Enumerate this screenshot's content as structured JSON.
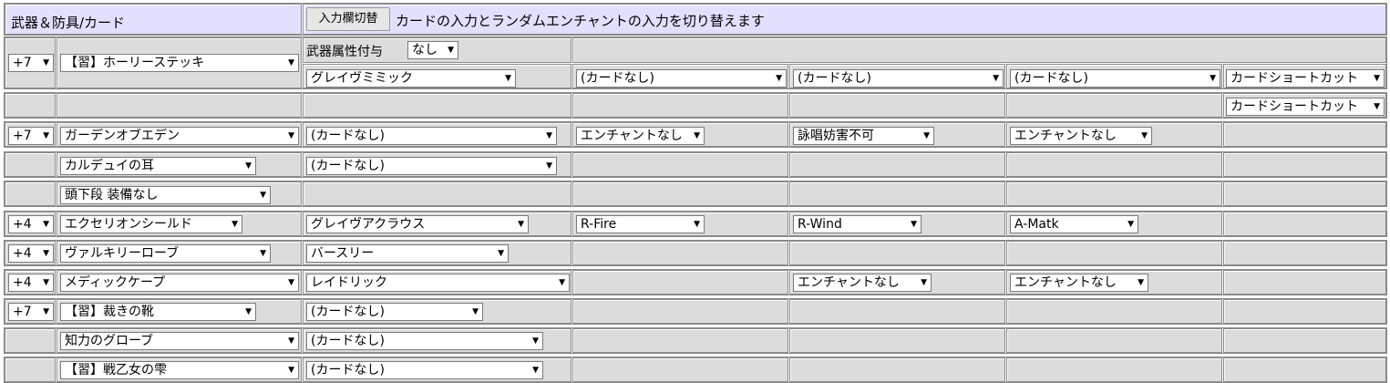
{
  "header": {
    "title": "武器＆防具/カード",
    "toggle_button": "入力欄切替",
    "toggle_description": "カードの入力とランダムエンチャントの入力を切り替えます"
  },
  "weapon": {
    "refine": "+7",
    "name": "【習】ホーリーステッキ",
    "element_label": "武器属性付与",
    "element_value": "なし",
    "card1": "グレイヴミミック",
    "card2": "(カードなし)",
    "card3": "(カードなし)",
    "card4": "(カードなし)",
    "shortcut": "カードショートカット"
  },
  "weapon2": {
    "shortcut": "カードショートカット"
  },
  "head_top": {
    "refine": "+7",
    "name": "ガーデンオブエデン",
    "card": "(カードなし)",
    "enchant1": "エンチャントなし",
    "enchant2": "詠唱妨害不可",
    "enchant3": "エンチャントなし"
  },
  "head_mid": {
    "name": "カルデュイの耳",
    "card": "(カードなし)"
  },
  "head_low": {
    "name": "頭下段 装備なし"
  },
  "shield": {
    "refine": "+4",
    "name": "エクセリオンシールド",
    "card": "グレイヴアクラウス",
    "enchant1": "R-Fire",
    "enchant2": "R-Wind",
    "enchant3": "A-Matk"
  },
  "body_armor": {
    "refine": "+4",
    "name": "ヴァルキリーローブ",
    "card": "バースリー"
  },
  "garment": {
    "refine": "+4",
    "name": "メディックケープ",
    "card": "レイドリック",
    "enchant2": "エンチャントなし",
    "enchant3": "エンチャントなし"
  },
  "shoes": {
    "refine": "+7",
    "name": "【習】裁きの靴",
    "card": "(カードなし)"
  },
  "accessory1": {
    "name": "知力のグローブ",
    "card": "(カードなし)"
  },
  "accessory2": {
    "name": "【習】戦乙女の雫",
    "card": "(カードなし)"
  }
}
